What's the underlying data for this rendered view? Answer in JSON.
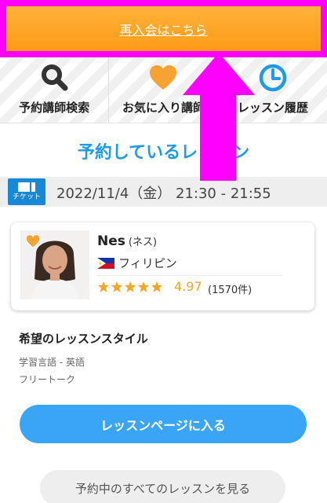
{
  "rejoin": {
    "label": "再入会はこちら"
  },
  "nav": {
    "items": [
      {
        "label": "予約講師検索",
        "icon": "search-icon"
      },
      {
        "label": "お気に入り講師",
        "icon": "heart-icon"
      },
      {
        "label": "レッスン履歴",
        "icon": "clock-icon"
      }
    ]
  },
  "section": {
    "title": "予約しているレッスン"
  },
  "lesson": {
    "ticket_label": "チケット",
    "datetime": "2022/11/4（金） 21:30 - 21:55"
  },
  "teacher": {
    "name": "Nes",
    "kana": "(ネス)",
    "country": "フィリピン",
    "rating": "4.97",
    "reviews": "(1570件)",
    "stars": 5
  },
  "style": {
    "title": "希望のレッスンスタイル",
    "language": "学習言語 - 英語",
    "type": "フリートーク"
  },
  "buttons": {
    "enter": "レッスンページに入る",
    "all": "予約中のすべてのレッスンを見る"
  },
  "colors": {
    "accent_orange": "#ff9a17",
    "accent_blue": "#1f9ae6",
    "annotation_magenta": "#ff00ff"
  }
}
